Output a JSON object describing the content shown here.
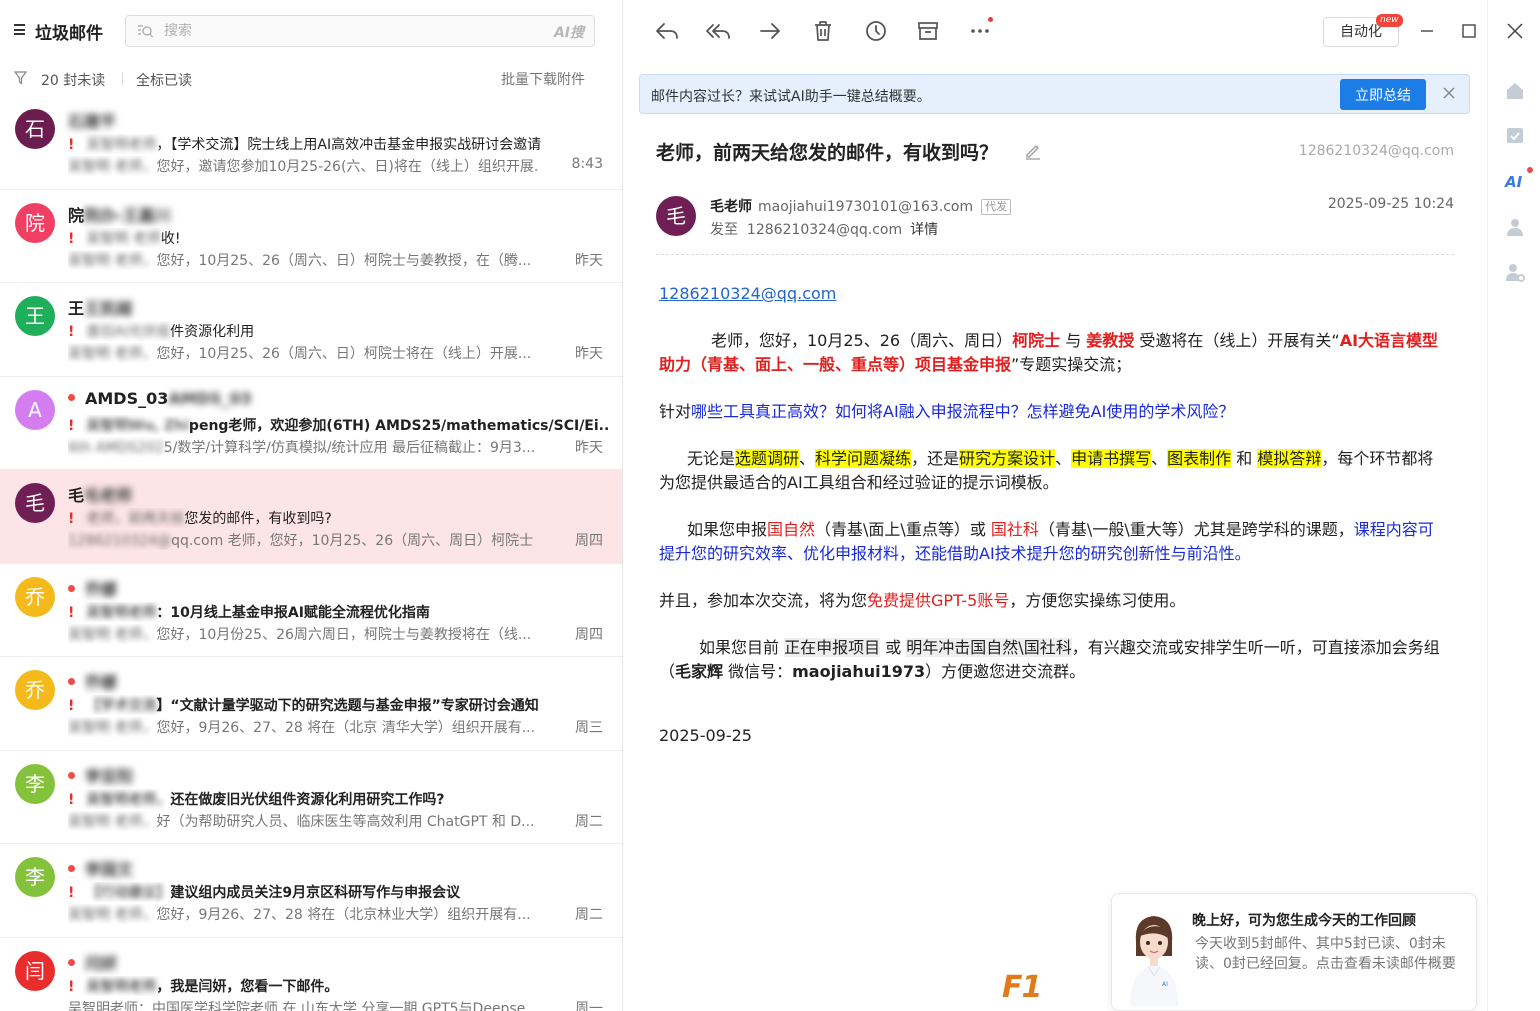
{
  "left": {
    "folder_title": "垃圾邮件",
    "search_placeholder": "搜索",
    "ai_search_label": "AI搜",
    "unread_count": "20 封未读",
    "mark_all_read": "全标已读",
    "batch_download": "批量下载附件",
    "mails": [
      {
        "avatar": "石",
        "avatar_color": "#6b1d4f",
        "sender": "石建平",
        "sender_visible": "",
        "unread": false,
        "subject_blur": "吴智明老师",
        "subject": "，【学术交流】院士线上用AI高效冲击基金申报实战研讨会邀请",
        "subject_bold": false,
        "preview_blur": "吴智明 老师，",
        "preview": "您好，邀请您参加10月25-26(六、日)将在（线上）组织开展...",
        "time": "8:43",
        "selected": false
      },
      {
        "avatar": "院",
        "avatar_color": "#ef3f62",
        "sender": "院办-王嘉川",
        "sender_visible": "院",
        "unread": false,
        "subject_blur": "吴智明 老师",
        "subject": "收!",
        "subject_bold": false,
        "preview_blur": "吴智明 老师，",
        "preview": "您好，10月25、26（周六、日）柯院士与姜教授，在（腾...",
        "time": "昨天",
        "selected": false
      },
      {
        "avatar": "王",
        "avatar_color": "#1fae59",
        "sender": "王凯越",
        "sender_visible": "王",
        "unread": false,
        "subject_blur": "废旧AI光伏组",
        "subject": "件资源化利用",
        "subject_bold": false,
        "preview_blur": "吴智明 老师，",
        "preview": "您好，10月25、26（周六、日）柯院士将在（线上）开展...",
        "time": "昨天",
        "selected": false
      },
      {
        "avatar": "A",
        "avatar_color": "#d37df0",
        "sender": "AMDS_03",
        "sender_visible": "AMDS_03",
        "unread": true,
        "subject_blur": "吴智明Wu, Zhi",
        "subject": "peng老师，欢迎参加(6TH) AMDS25/mathematics/SCI/Ei...",
        "subject_bold": true,
        "preview_blur": "6th AMDS202",
        "preview": "5/数学/计算科学/仿真模拟/统计应用 最后征稿截止：9月3...",
        "time": "昨天",
        "selected": false
      },
      {
        "avatar": "毛",
        "avatar_color": "#6f1f54",
        "sender": "毛老师",
        "sender_visible": "毛",
        "unread": false,
        "subject_blur": "老师，前两天给",
        "subject": "您发的邮件，有收到吗?",
        "subject_bold": false,
        "preview_blur": "1286210324@",
        "preview": "qq.com 老师，您好，10月25、26（周六、周日）柯院士 ...",
        "time": "周四",
        "selected": true
      },
      {
        "avatar": "乔",
        "avatar_color": "#f4b91b",
        "sender": "乔娜",
        "sender_visible": "",
        "unread": true,
        "subject_blur": "吴智明老师",
        "subject": "：10月线上基金申报AI赋能全流程优化指南",
        "subject_bold": true,
        "preview_blur": "吴智明 老师，",
        "preview": "您好，10月份25、26周六周日，柯院士与姜教授将在（线...",
        "time": "周四",
        "selected": false
      },
      {
        "avatar": "乔",
        "avatar_color": "#f4b91b",
        "sender": "乔娜",
        "sender_visible": "",
        "unread": true,
        "subject_blur": "【学术交流",
        "subject": "】“文献计量学驱动下的研究选题与基金申报”专家研讨会通知",
        "subject_bold": true,
        "preview_blur": "吴智明 老师，",
        "preview": "您好，9月26、27、28 将在（北京 清华大学）组织开展有...",
        "time": "周三",
        "selected": false
      },
      {
        "avatar": "李",
        "avatar_color": "#84c23c",
        "sender": "李亚阳",
        "sender_visible": "",
        "unread": true,
        "subject_blur": "吴智明老师，",
        "subject": "还在做废旧光伏组件资源化利用研究工作吗?",
        "subject_bold": true,
        "preview_blur": "吴智明 老师，",
        "preview": "好（为帮助研究人员、临床医生等高效利用 ChatGPT 和 D...",
        "time": "周二",
        "selected": false
      },
      {
        "avatar": "李",
        "avatar_color": "#84c23c",
        "sender": "李国文",
        "sender_visible": "",
        "unread": true,
        "subject_blur": "【行动建议】",
        "subject": "建议组内成员关注9月京区科研写作与申报会议",
        "subject_bold": true,
        "preview_blur": "吴智明 老师，",
        "preview": "您好，9月26、27、28 将在（北京林业大学）组织开展有...",
        "time": "周二",
        "selected": false
      },
      {
        "avatar": "闫",
        "avatar_color": "#e92d2d",
        "sender": "闫妍",
        "sender_visible": "",
        "unread": true,
        "subject_blur": "吴智明老师",
        "subject": "，我是闫妍，您看一下邮件。",
        "subject_bold": true,
        "preview_blur": "",
        "preview": "吴智明老师：中国医学科学院老师 在 山东大学 分享一期 GPT5与Deepse...",
        "time": "周一",
        "selected": false
      }
    ]
  },
  "toolbar": {
    "automation_label": "自动化",
    "new_badge": "new"
  },
  "ai_banner": {
    "message": "邮件内容过长？来试试AI助手一键总结概要。",
    "button": "立即总结"
  },
  "mail": {
    "subject": "老师，前两天给您发的邮件，有收到吗？",
    "to_top": "1286210324@qq.com",
    "sender_avatar": "毛",
    "sender_name": "毛老师",
    "sender_addr": "maojiahui19730101@163.com",
    "daifa": "代发",
    "to_prefix": "发至",
    "to_addr": "1286210324@qq.com",
    "detail": "详情",
    "date": "2025-09-25 10:24",
    "body": {
      "link": "1286210324@qq.com",
      "p1_a": "老师，您好，10月25、26（周六、周日）",
      "p1_b": "柯院士",
      "p1_c": " 与 ",
      "p1_d": "姜教授",
      "p1_e": " 受邀将在（线上）开展有关“",
      "p1_f": "AI大语言模型助力（青基、面上、一般、重点等）项目基金申报",
      "p1_g": "”专题实操交流；",
      "p2_a": "针对",
      "p2_b": "哪些工具真正高效？如何将AI融入申报流程中？怎样避免AI使用的学术风险？",
      "p3_a": "无论是",
      "p3_b": "选题调研",
      "p3_c": "、",
      "p3_d": "科学问题凝练",
      "p3_e": "，还是",
      "p3_f": "研究方案设计",
      "p3_g": "、",
      "p3_h": "申请书撰写",
      "p3_i": "、",
      "p3_j": "图表制作",
      "p3_k": " 和 ",
      "p3_l": "模拟答辩",
      "p3_m": "，每个环节都将为您提供最适合的AI工具组合和经过验证的提示词模板。",
      "p4_a": "如果您申报",
      "p4_b": "国自然",
      "p4_c": "（青基\\面上\\重点等）或 ",
      "p4_d": "国社科",
      "p4_e": "（青基\\一般\\重大等）尤其是跨学科的课题，",
      "p4_f": "课程内容可提升您的研究效率、优化申报材料，还能借助AI技术提升您的研究创新性与前沿性。",
      "p5_a": "并且，参加本次交流，将为您",
      "p5_b": "免费提供GPT-5账号",
      "p5_c": "，方便您实操练习使用。",
      "p6_a": "如果您目前 ",
      "p6_b": "正在申报项目",
      "p6_c": " 或 ",
      "p6_d": "明年冲击国自然\\国社科",
      "p6_e": "，有兴趣交流或安排学生听一听，可直接添加会务组（",
      "p6_f": "毛家辉",
      "p6_g": "  微信号：",
      "p6_h": "maojiahui1973",
      "p6_i": "）方便邀您进交流群。",
      "sig_date": "2025-09-25"
    }
  },
  "ai_card": {
    "greeting": "晚上好，可为您生成今天的工作回顾",
    "summary": "今天收到5封邮件、其中5封已读、0封未读、0封已经回复。点击查看未读邮件概要"
  },
  "f1_label": "F1",
  "colors": {
    "accent": "#1c7de6",
    "selected_row": "#fde4e6",
    "banner_bg": "#e6f0fd",
    "red_text": "#e02020",
    "blue_text": "#1a2ad8",
    "highlight": "#ffff00"
  }
}
